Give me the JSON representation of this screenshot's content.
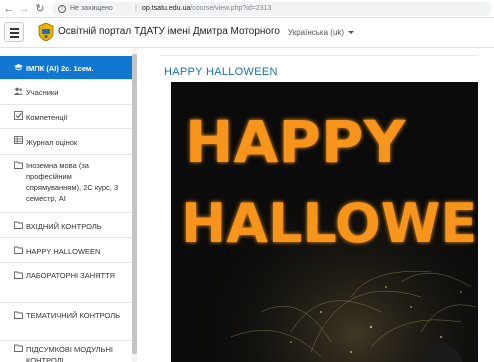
{
  "browser": {
    "security_label": "Не захищено",
    "url_host": "op.tsatu.edu.ua",
    "url_path": "/course/view.php?id=2313"
  },
  "navbar": {
    "site_name": "Освітній портал ТДАТУ імені Дмитра Моторного",
    "language": "Українська (uk)"
  },
  "drawer": {
    "items": [
      {
        "label": "ІМПК (AI) 2с. 1сем.",
        "icon": "graduation-cap-icon",
        "active": true
      },
      {
        "label": "Учасники",
        "icon": "users-icon"
      },
      {
        "label": "Компетенції",
        "icon": "checkbox-icon"
      },
      {
        "label": "Журнал оцінок",
        "icon": "table-icon"
      },
      {
        "label": "Іноземна мова (за професійним спрямуванням), 2С курс, 3 семестр, AI",
        "icon": "folder-icon"
      },
      {
        "label": "ВХІДНИЙ КОНТРОЛЬ",
        "icon": "folder-icon"
      },
      {
        "label": "HAPPY HALLOWEEN",
        "icon": "folder-icon"
      },
      {
        "label": "ЛАБОРАТОРНІ ЗАНЯТТЯ",
        "icon": "folder-icon"
      },
      {
        "label": "ТЕМАТИЧНИЙ КОНТРОЛЬ",
        "icon": "folder-icon"
      },
      {
        "label": "ПІДСУМКОВІ МОДУЛЬНІ КОНТРОЛІ",
        "icon": "folder-icon"
      }
    ]
  },
  "main": {
    "section_title": "HAPPY HALLOWEEN",
    "image_text_line1": "HAPPY",
    "image_text_line2": "HALLOWEEN",
    "accent_color": "#f7941d"
  }
}
